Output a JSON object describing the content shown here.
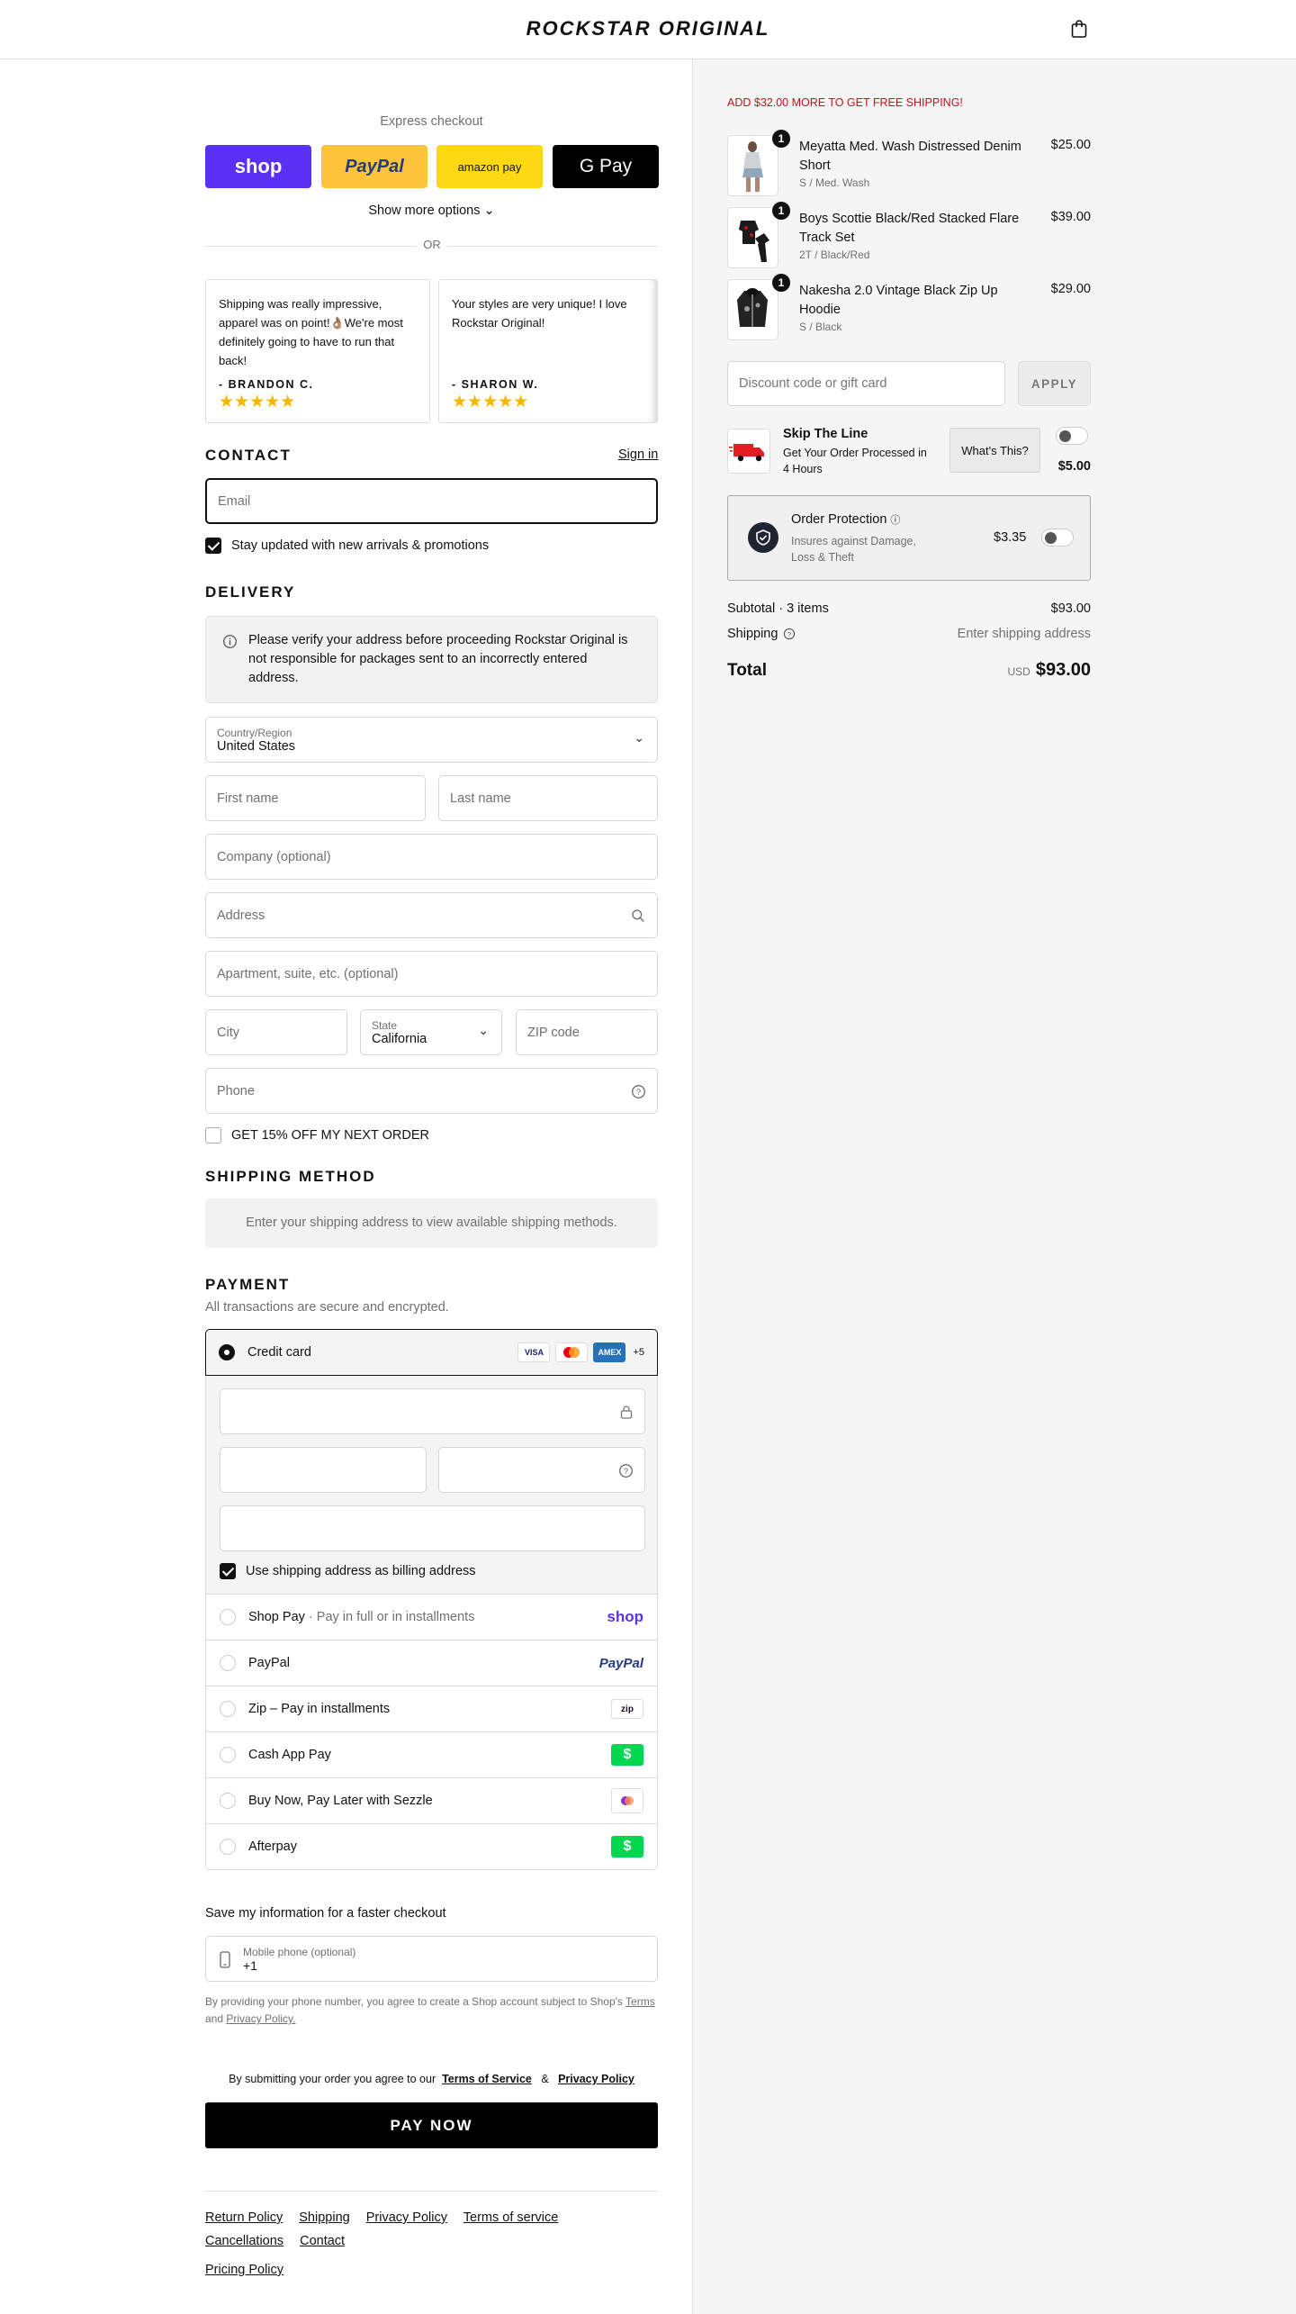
{
  "header": {
    "logo": "ROCKSTAR ORIGINAL",
    "cart_icon": "shopping-bag-icon"
  },
  "express": {
    "title": "Express checkout",
    "buttons": [
      {
        "label": "shop",
        "color": "#5a31f4"
      },
      {
        "label": "PayPal",
        "color": "#ffc439"
      },
      {
        "label": "amazon pay",
        "color": "#ffd814"
      },
      {
        "label": "G Pay",
        "color": "#000000"
      }
    ],
    "show_more": "Show more options",
    "or": "OR"
  },
  "reviews": [
    {
      "text": "Shipping was really impressive, apparel was on point!👌🏽We're most definitely going to have to run that back!",
      "author": "- BRANDON C.",
      "stars": "★★★★★"
    },
    {
      "text": "Your styles are very unique! I love Rockstar Original!",
      "author": "- SHARON W.",
      "stars": "★★★★★"
    }
  ],
  "contact": {
    "title": "CONTACT",
    "sign_in": "Sign in",
    "email_placeholder": "Email",
    "newsletter_label": "Stay updated with new arrivals & promotions",
    "newsletter_checked": true
  },
  "delivery": {
    "title": "DELIVERY",
    "notice": "Please verify your address before proceeding Rockstar Original is not responsible for packages sent to an incorrectly entered address.",
    "country_label": "Country/Region",
    "country_value": "United States",
    "first_name": "First name",
    "last_name": "Last name",
    "company": "Company (optional)",
    "address": "Address",
    "apartment": "Apartment, suite, etc. (optional)",
    "city": "City",
    "state_label": "State",
    "state_value": "California",
    "zip": "ZIP code",
    "phone": "Phone",
    "offer_label": "GET 15% OFF MY NEXT ORDER"
  },
  "shipping_method": {
    "title": "SHIPPING METHOD",
    "message": "Enter your shipping address to view available shipping methods."
  },
  "payment": {
    "title": "PAYMENT",
    "subtitle": "All transactions are secure and encrypted.",
    "credit_card_label": "Credit card",
    "card_brands": [
      "VISA",
      "MC",
      "AMEX"
    ],
    "more_brands": "+5",
    "billing_label": "Use shipping address as billing address",
    "methods": [
      {
        "label": "Shop Pay",
        "sub": "· Pay in full or in installments",
        "logo": "shop"
      },
      {
        "label": "PayPal",
        "sub": "",
        "logo": "PayPal"
      },
      {
        "label": "Zip – Pay in installments",
        "sub": "",
        "logo": "zip"
      },
      {
        "label": "Cash App Pay",
        "sub": "",
        "logo": "$"
      },
      {
        "label": "Buy Now, Pay Later with Sezzle",
        "sub": "",
        "logo": "sezzle-icon"
      },
      {
        "label": "Afterpay",
        "sub": "",
        "logo": "$"
      }
    ]
  },
  "save_info": {
    "title": "Save my information for a faster checkout",
    "phone_label": "Mobile phone (optional)",
    "phone_value": "+1",
    "disclaimer_pre": "By providing your phone number, you agree to create a Shop account subject to Shop's",
    "terms": "Terms",
    "and": "and",
    "privacy": "Privacy Policy."
  },
  "submit": {
    "agree_text": "By submitting your order you agree to our",
    "tos": "Terms of Service",
    "amp": "&",
    "privacy": "Privacy Policy",
    "pay_now": "PAY NOW"
  },
  "footer": {
    "links": [
      "Return Policy",
      "Shipping",
      "Privacy Policy",
      "Terms of service",
      "Cancellations",
      "Contact"
    ],
    "pricing": "Pricing Policy"
  },
  "summary": {
    "free_shipping": "ADD $32.00 MORE TO GET FREE SHIPPING!",
    "items": [
      {
        "name": "Meyatta Med. Wash Distressed Denim Short",
        "variant": "S / Med. Wash",
        "price": "$25.00",
        "qty": "1"
      },
      {
        "name": "Boys Scottie Black/Red Stacked Flare Track Set",
        "variant": "2T / Black/Red",
        "price": "$39.00",
        "qty": "1"
      },
      {
        "name": "Nakesha 2.0 Vintage Black Zip Up Hoodie",
        "variant": "S / Black",
        "price": "$29.00",
        "qty": "1"
      }
    ],
    "discount_placeholder": "Discount code or gift card",
    "apply": "APPLY",
    "skip": {
      "title": "Skip The Line",
      "desc": "Get Your Order Processed in 4 Hours",
      "whats": "What's This?",
      "price": "$5.00"
    },
    "protection": {
      "title": "Order Protection",
      "desc": "Insures against Damage, Loss & Theft",
      "price": "$3.35"
    },
    "subtotal_label": "Subtotal · 3 items",
    "subtotal": "$93.00",
    "shipping_label": "Shipping",
    "shipping_value": "Enter shipping address",
    "total_label": "Total",
    "currency": "USD",
    "total": "$93.00"
  },
  "colors": {
    "accent": "#111111",
    "alert": "#c1121f",
    "shop": "#5a31f4"
  }
}
